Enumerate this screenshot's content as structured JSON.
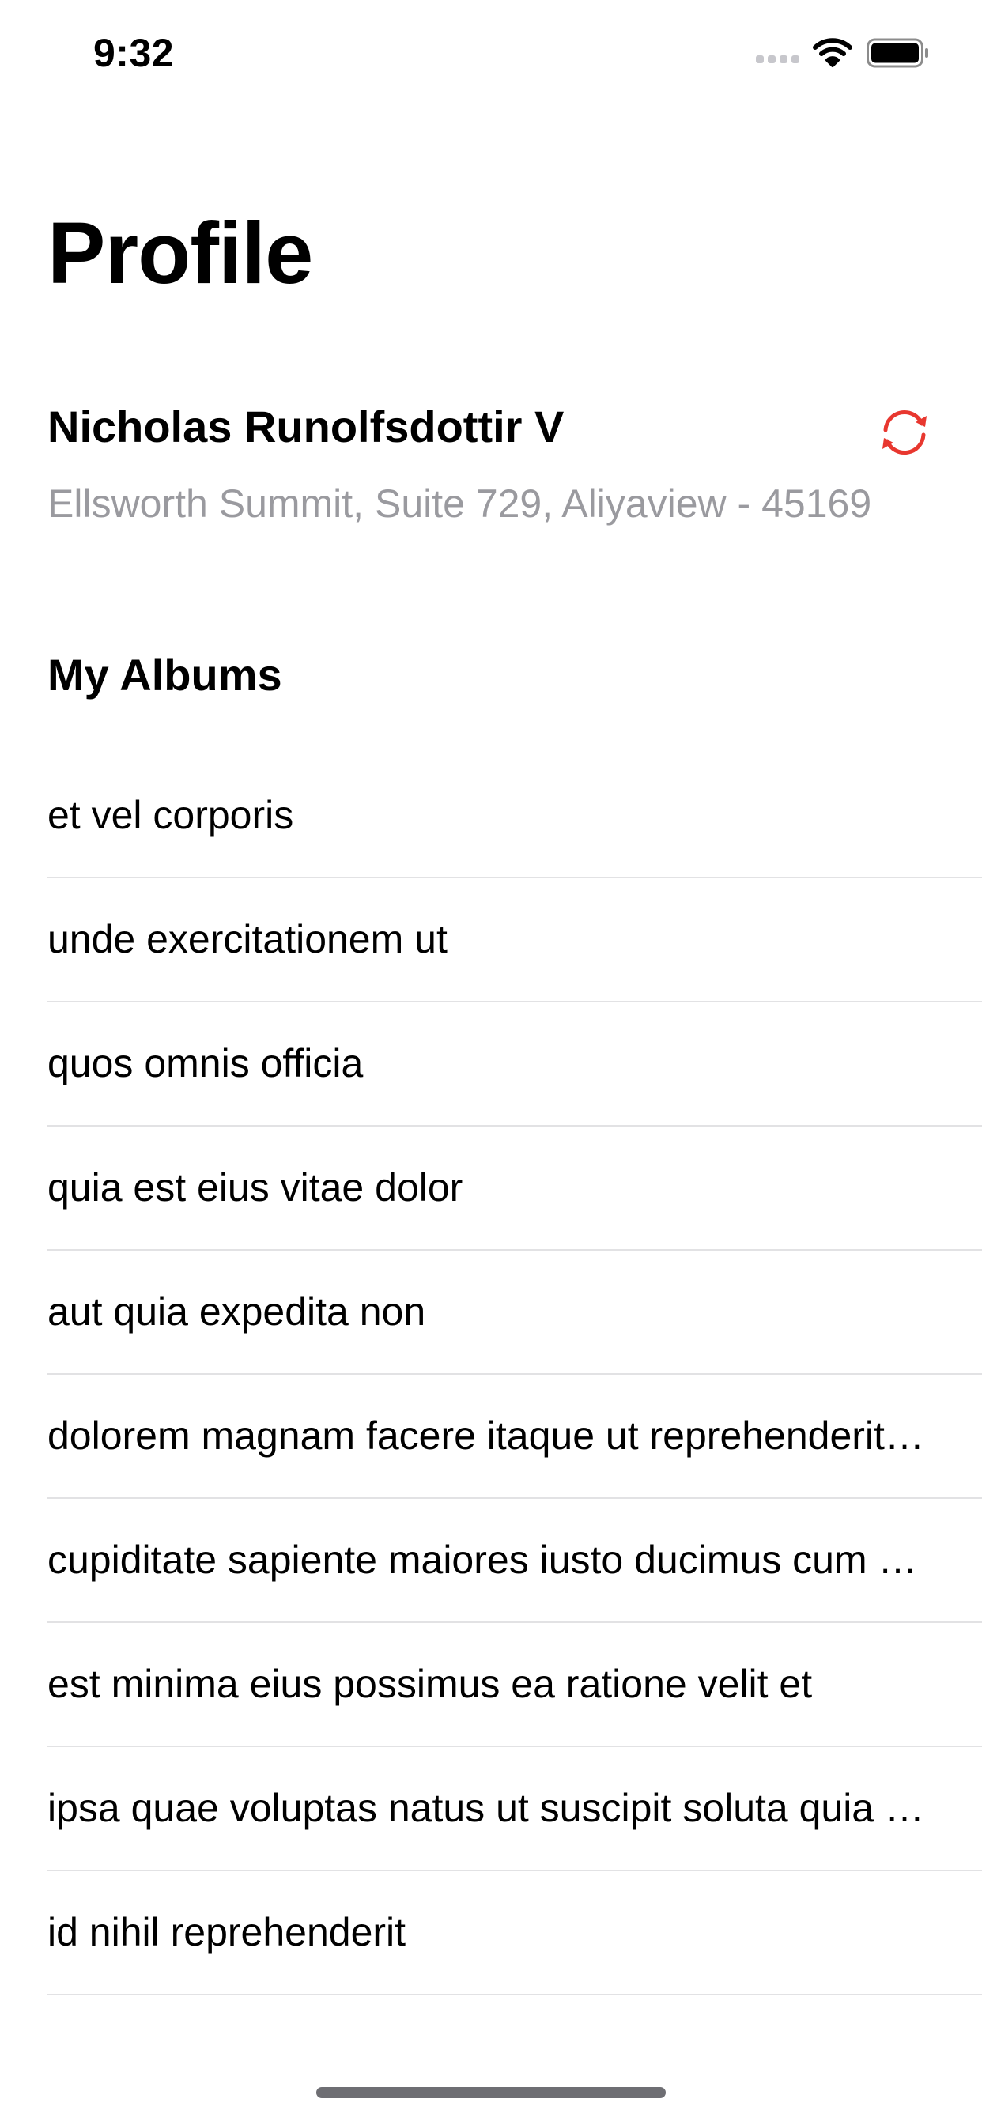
{
  "status_bar": {
    "time": "9:32",
    "signal_icon": "cellular-signal-icon",
    "wifi_icon": "wifi-icon",
    "battery_icon": "battery-icon"
  },
  "header": {
    "title": "Profile"
  },
  "profile": {
    "name": "Nicholas Runolfsdottir V",
    "address": "Ellsworth Summit, Suite 729, Aliyaview - 45169",
    "refresh_icon": "refresh-icon",
    "accent_color": "#e8372f"
  },
  "albums": {
    "section_title": "My Albums",
    "items": [
      {
        "title": "et vel corporis"
      },
      {
        "title": "unde exercitationem ut"
      },
      {
        "title": "quos omnis officia"
      },
      {
        "title": "quia est eius vitae dolor"
      },
      {
        "title": "aut quia expedita non"
      },
      {
        "title": "dolorem magnam facere itaque ut reprehenderit tenetur corrupti"
      },
      {
        "title": "cupiditate sapiente maiores iusto ducimus cum excepturi veritatis quia"
      },
      {
        "title": "est minima eius possimus ea ratione velit et"
      },
      {
        "title": "ipsa quae voluptas natus ut suscipit soluta quia quidem"
      },
      {
        "title": "id nihil reprehenderit"
      }
    ]
  }
}
